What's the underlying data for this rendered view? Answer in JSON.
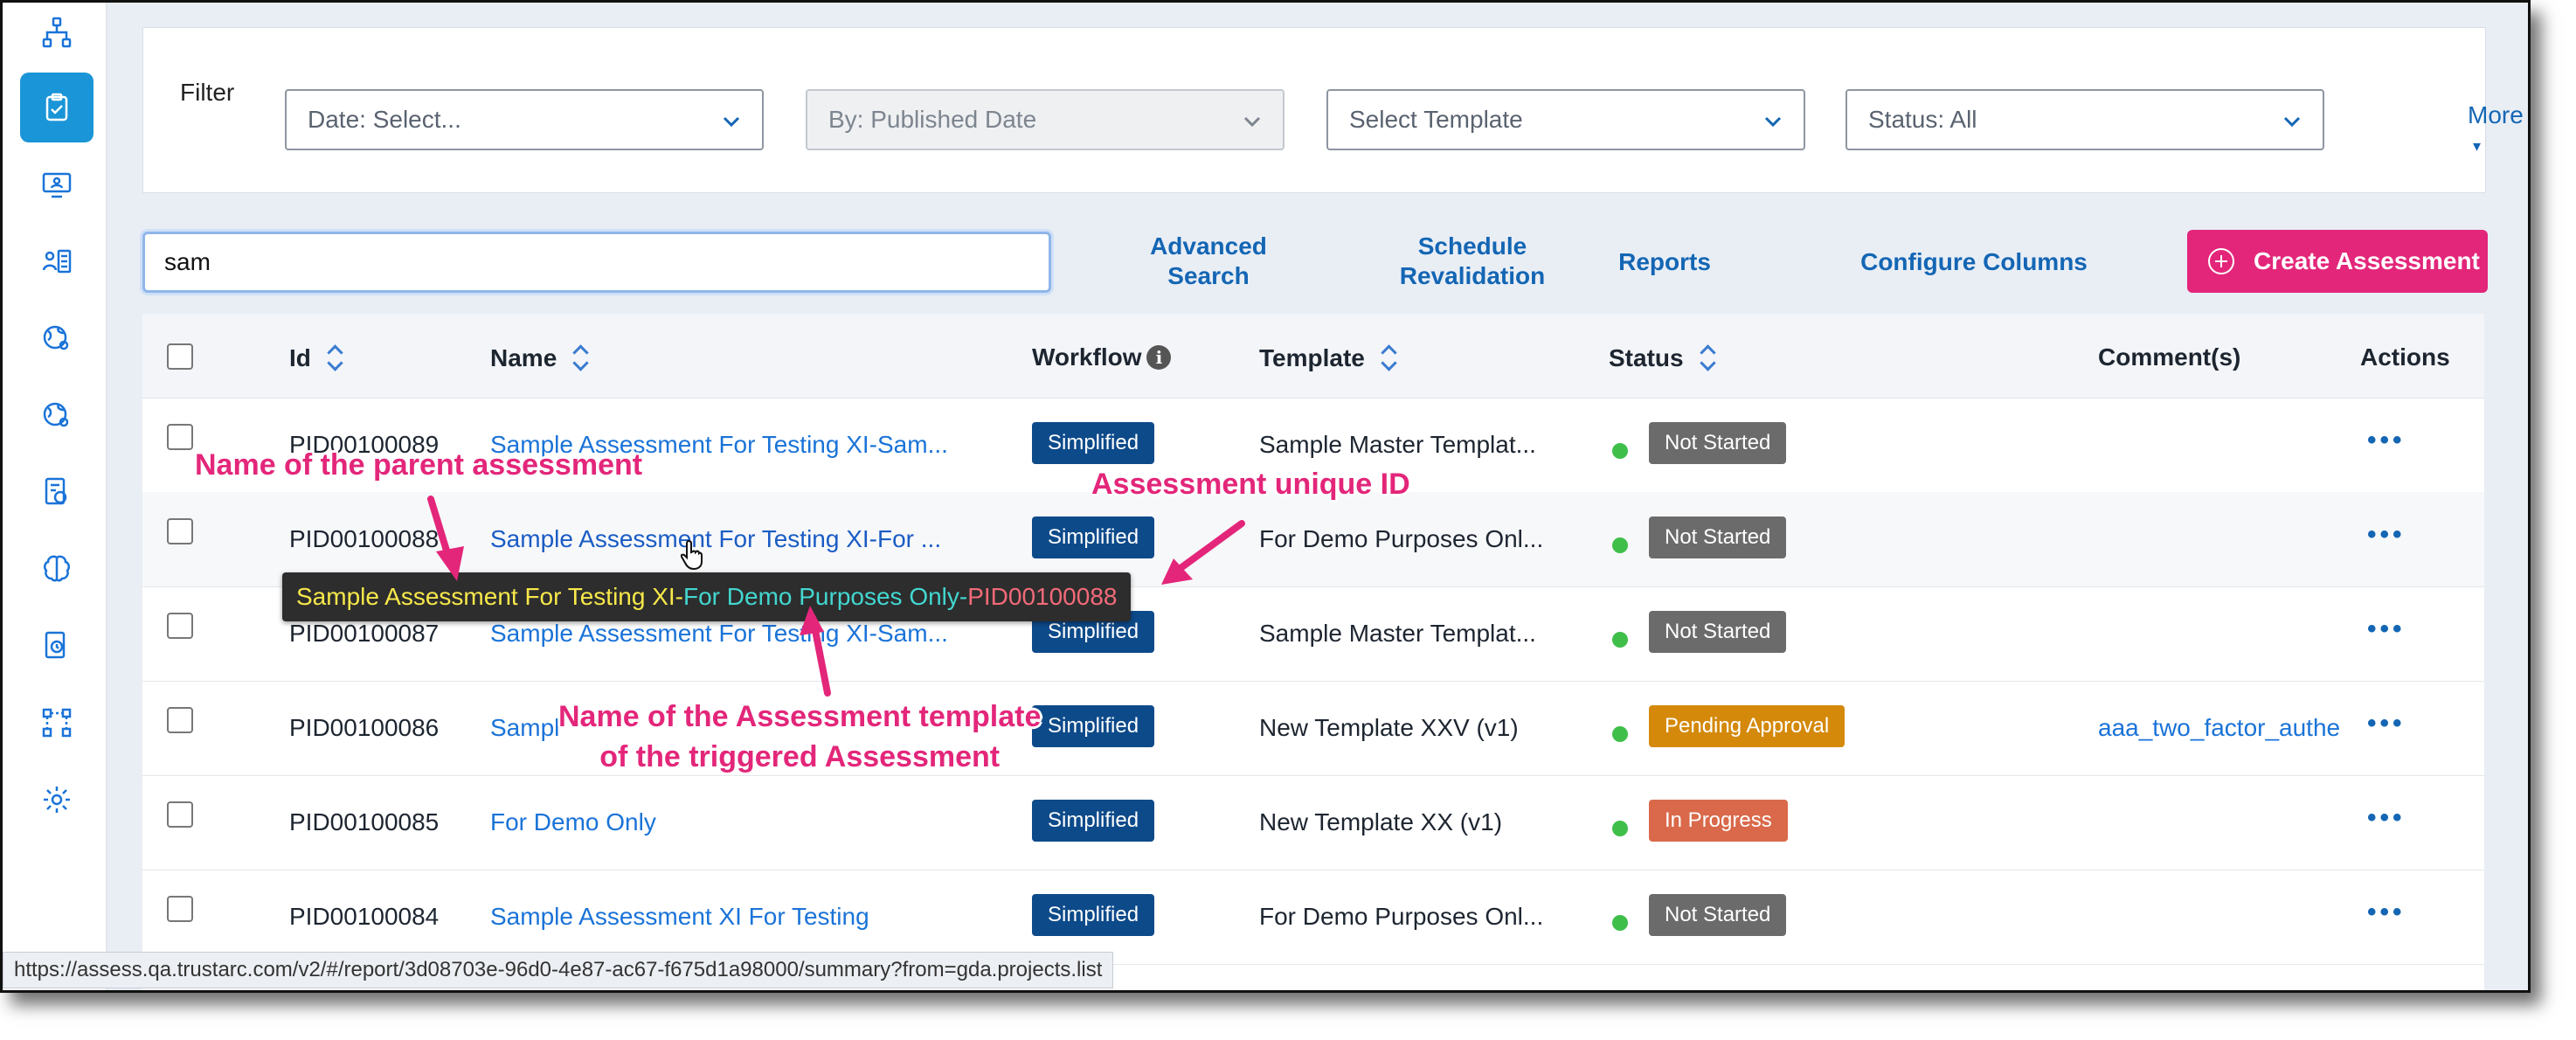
{
  "filter": {
    "label": "Filter",
    "date_select": "Date: Select...",
    "by_select": "By: Published Date",
    "template_select": "Select Template",
    "status_select": "Status: All",
    "more": "More"
  },
  "search": {
    "value": "sam"
  },
  "toolbar": {
    "advanced_search_1": "Advanced",
    "advanced_search_2": "Search",
    "schedule_1": "Schedule",
    "schedule_2": "Revalidation",
    "reports": "Reports",
    "configure_columns": "Configure Columns",
    "create": "Create Assessment"
  },
  "table": {
    "headers": {
      "id": "Id",
      "name": "Name",
      "workflow": "Workflow",
      "template": "Template",
      "status": "Status",
      "comments": "Comment(s)",
      "actions": "Actions"
    },
    "rows": [
      {
        "id": "PID00100089",
        "name": "Sample Assessment For Testing XI-Sam...",
        "workflow": "Simplified",
        "template": "Sample Master Templat...",
        "status": "Not Started",
        "comment": ""
      },
      {
        "id": "PID00100088",
        "name": "Sample Assessment For Testing XI-For ...",
        "workflow": "Simplified",
        "template": "For Demo Purposes Onl...",
        "status": "Not Started",
        "comment": ""
      },
      {
        "id": "PID00100087",
        "name": "Sample Assessment For Testing XI-Sam...",
        "workflow": "Simplified",
        "template": "Sample Master Templat...",
        "status": "Not Started",
        "comment": ""
      },
      {
        "id": "PID00100086",
        "name": "Sampl",
        "workflow": "Simplified",
        "template": "New Template XXV (v1)",
        "status": "Pending Approval",
        "comment": "aaa_two_factor_authe"
      },
      {
        "id": "PID00100085",
        "name": "For Demo Only",
        "workflow": "Simplified",
        "template": "New Template XX (v1)",
        "status": "In Progress",
        "comment": ""
      },
      {
        "id": "PID00100084",
        "name": "Sample Assessment XI For Testing",
        "workflow": "Simplified",
        "template": "For Demo Purposes Onl...",
        "status": "Not Started",
        "comment": ""
      }
    ],
    "actions_glyph": "•••"
  },
  "tooltip": {
    "part_parent": "Sample Assessment For Testing XI",
    "sep1": "-",
    "part_template": "For Demo Purposes Only",
    "sep2": "-",
    "part_id": "PID00100088"
  },
  "annotations": {
    "parent": "Name of the parent assessment",
    "unique_id": "Assessment unique ID",
    "template_1": "Name of the Assessment template",
    "template_2": "of the triggered Assessment"
  },
  "statusbar": {
    "url": "https://assess.qa.trustarc.com/v2/#/report/3d08703e-96d0-4e87-ac67-f675d1a98000/summary?from=gda.projects.list"
  },
  "colors": {
    "accent": "#e3267a",
    "link": "#1a73d8",
    "workflow_badge": "#0d4a8a",
    "not_started": "#6b6b6b",
    "pending_approval": "#d4890a",
    "in_progress": "#d9694a",
    "sidebar_active": "#1a95d7"
  },
  "sidebar_icons": [
    "hierarchy-icon",
    "clipboard-icon",
    "monitor-user-icon",
    "user-list-icon",
    "globe-gear-icon",
    "globe-gear-icon",
    "document-gear-icon",
    "brain-icon",
    "document-clock-icon",
    "flow-icon",
    "settings-icon"
  ]
}
